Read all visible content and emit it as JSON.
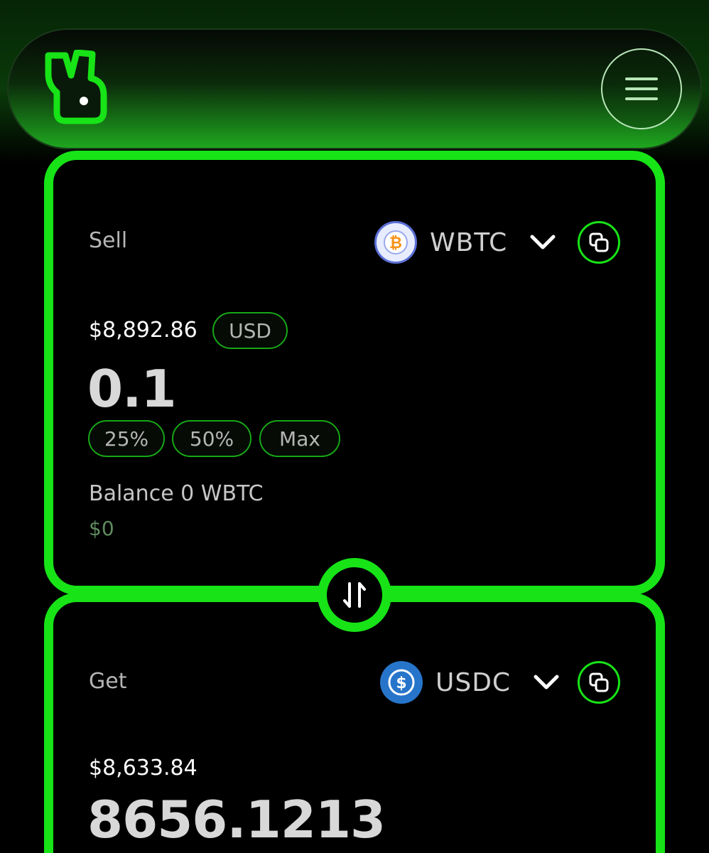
{
  "header": {
    "logo_icon": "rabbit-logo-icon",
    "menu_icon": "hamburger-menu-icon"
  },
  "sell": {
    "label": "Sell",
    "token": "WBTC",
    "token_icon": "bitcoin-icon",
    "usd_value": "$8,892.86",
    "currency_toggle": "USD",
    "amount": "0.1",
    "percent_buttons": [
      "25%",
      "50%",
      "Max"
    ],
    "balance": "Balance 0 WBTC",
    "balance_usd": "$0"
  },
  "get": {
    "label": "Get",
    "token": "USDC",
    "token_icon": "usdc-icon",
    "usd_value": "$8,633.84",
    "amount": "8656.1213"
  },
  "swap_icon": "swap-direction-icon",
  "colors": {
    "accent": "#17e317",
    "background": "#000000",
    "muted_text": "#b5b5b5",
    "usdc_blue": "#2775ca",
    "btc_orange": "#f7931a"
  }
}
